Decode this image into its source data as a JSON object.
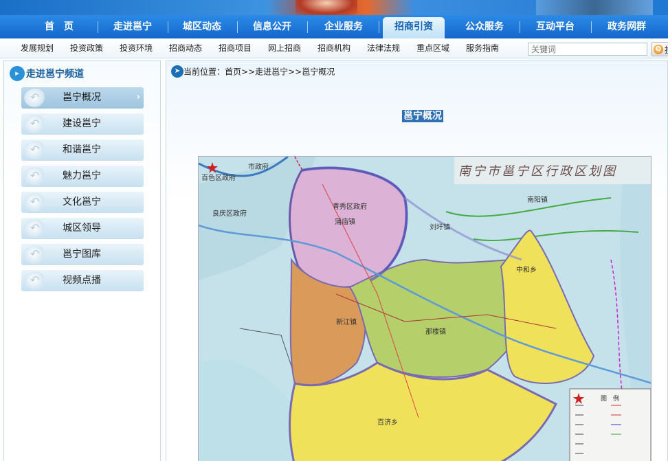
{
  "nav": {
    "items": [
      {
        "label": "首　页"
      },
      {
        "label": "走进邕宁"
      },
      {
        "label": "城区动态"
      },
      {
        "label": "信息公开"
      },
      {
        "label": "企业服务"
      },
      {
        "label": "招商引资",
        "active": true
      },
      {
        "label": "公众服务"
      },
      {
        "label": "互动平台"
      },
      {
        "label": "政务网群"
      }
    ]
  },
  "subnav": {
    "items": [
      "发展规划",
      "投资政策",
      "投资环境",
      "招商动态",
      "招商项目",
      "网上招商",
      "招商机构",
      "法律法规",
      "重点区域",
      "服务指南"
    ]
  },
  "search": {
    "placeholder": "关键词",
    "button_label": "搜"
  },
  "sidebar": {
    "title": "走进邕宁频道",
    "items": [
      {
        "label": "邕宁概况",
        "active": true
      },
      {
        "label": "建设邕宁"
      },
      {
        "label": "和谐邕宁"
      },
      {
        "label": "魅力邕宁"
      },
      {
        "label": "文化邕宁"
      },
      {
        "label": "城区领导"
      },
      {
        "label": "邕宁图库"
      },
      {
        "label": "视频点播"
      }
    ]
  },
  "breadcrumb": {
    "prefix": "当前位置：",
    "path": "首页>>走进邕宁>>邕宁概况"
  },
  "page_title": "邕宁概况",
  "map": {
    "title": "南宁市邕宁区行政区划图",
    "legend_title": "图　例",
    "labels": {
      "city_gov": "市政府",
      "baise": "百色区政府",
      "qingxiu": "青秀区政府",
      "liangqing": "良庆区政府",
      "liuxu": "刘圩镇",
      "nanyang": "南阳镇",
      "xinjiang": "新江镇",
      "nalou": "那楼镇",
      "baiji": "百济乡",
      "zhonghe": "中和乡",
      "pumiao": "蒲庙镇"
    }
  },
  "colors": {
    "nav_bg": "#1467cc",
    "active_nav_text": "#1661b6",
    "page_title_bg": "#2f6fb3",
    "map_pink": "#dcb2d6",
    "map_orange": "#d99a5a",
    "map_green": "#b5cf6b",
    "map_yellow": "#f0e15a"
  },
  "icons": {
    "sidebar_title": "channel-arrow-icon",
    "breadcrumb": "location-arrow-icon",
    "side_item": "swirl-arrow-icon",
    "chevron": "chevron-right-icon",
    "search": "search-icon"
  }
}
